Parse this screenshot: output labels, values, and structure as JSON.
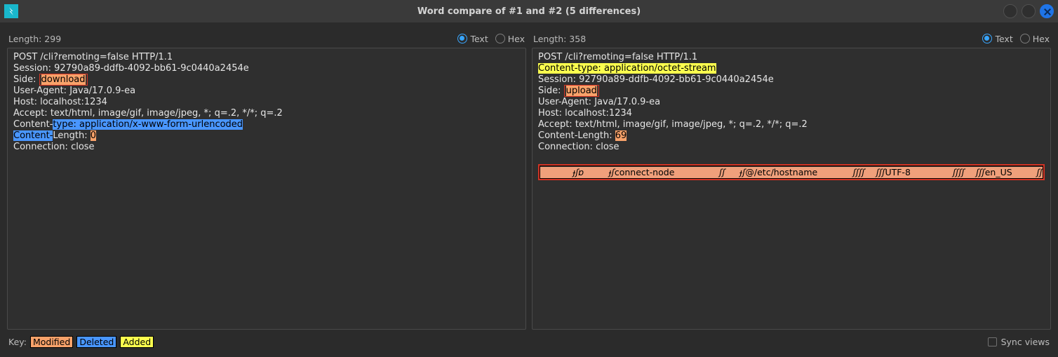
{
  "title": "Word compare of #1 and #2  (5 differences)",
  "view_modes": {
    "text": "Text",
    "hex": "Hex"
  },
  "left": {
    "length_label": "Length: 299",
    "lines": {
      "l0": "POST /cli?remoting=false HTTP/1.1",
      "l1": "Session: 92790a89-ddfb-4092-bb61-9c0440a2454e",
      "l2_pre": "Side: ",
      "l2_mod": "download",
      "l3": "User-Agent: Java/17.0.9-ea",
      "l4": "Host: localhost:1234",
      "l5": "Accept: text/html, image/gif, image/jpeg, *; q=.2, */*; q=.2",
      "l6_pre": "Content-",
      "l6_del": "type: application/x-www-form-urlencoded",
      "l7_del": "Content-",
      "l7_mid": "Length: ",
      "l7_mod": "0",
      "l8": "Connection: close"
    }
  },
  "right": {
    "length_label": "Length: 358",
    "lines": {
      "r0": "POST /cli?remoting=false HTTP/1.1",
      "r1_add": "Content-type: application/octet-stream",
      "r2": "Session: 92790a89-ddfb-4092-bb61-9c0440a2454e",
      "r3_pre": "Side: ",
      "r3_mod": "upload",
      "r4": "User-Agent: Java/17.0.9-ea",
      "r5": "Host: localhost:1234",
      "r6": "Accept: text/html, image/gif, image/jpeg, *; q=.2, */*; q=.2",
      "r7_pre": "Content-Length: ",
      "r7_mod": "69",
      "r8": "Connection: close",
      "bin": {
        "s1": "ɟʃɒ",
        "s2": "ɟʃ",
        "s3": "connect-node",
        "s4": "ʃʃ",
        "s5": "ɟʃ",
        "s6": "@/etc/hostname",
        "s7": "ʃʃʃʃ",
        "s8": "ʃʃʃ",
        "s9": "UTF-8",
        "s10": "ʃʃʃʃ",
        "s11": "ʃʃʃ",
        "s12": "en_US",
        "s13": "ʃʃ"
      }
    }
  },
  "key": {
    "label": "Key:",
    "modified": "Modified",
    "deleted": "Deleted",
    "added": "Added"
  },
  "sync_label": "Sync views"
}
